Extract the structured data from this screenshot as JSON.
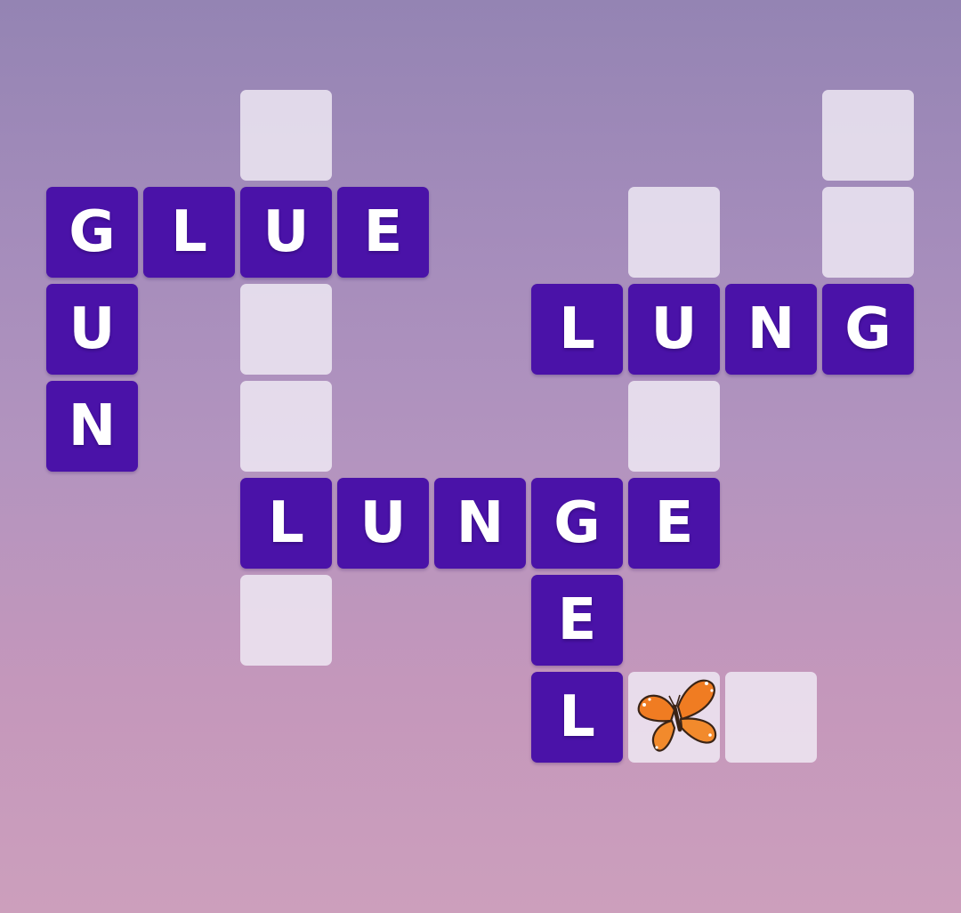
{
  "puzzle": {
    "found_words": [
      "GLUE",
      "GUN",
      "LUNG",
      "LUNGE",
      "GEL"
    ],
    "tiles": [
      {
        "row": 0,
        "col": 2,
        "letter": "",
        "state": "empty"
      },
      {
        "row": 0,
        "col": 8,
        "letter": "",
        "state": "empty"
      },
      {
        "row": 1,
        "col": 0,
        "letter": "G",
        "state": "filled"
      },
      {
        "row": 1,
        "col": 1,
        "letter": "L",
        "state": "filled"
      },
      {
        "row": 1,
        "col": 2,
        "letter": "U",
        "state": "filled"
      },
      {
        "row": 1,
        "col": 3,
        "letter": "E",
        "state": "filled"
      },
      {
        "row": 1,
        "col": 6,
        "letter": "",
        "state": "empty"
      },
      {
        "row": 1,
        "col": 8,
        "letter": "",
        "state": "empty"
      },
      {
        "row": 2,
        "col": 0,
        "letter": "U",
        "state": "filled"
      },
      {
        "row": 2,
        "col": 2,
        "letter": "",
        "state": "empty"
      },
      {
        "row": 2,
        "col": 5,
        "letter": "L",
        "state": "filled"
      },
      {
        "row": 2,
        "col": 6,
        "letter": "U",
        "state": "filled"
      },
      {
        "row": 2,
        "col": 7,
        "letter": "N",
        "state": "filled"
      },
      {
        "row": 2,
        "col": 8,
        "letter": "G",
        "state": "filled"
      },
      {
        "row": 3,
        "col": 0,
        "letter": "N",
        "state": "filled"
      },
      {
        "row": 3,
        "col": 2,
        "letter": "",
        "state": "empty"
      },
      {
        "row": 3,
        "col": 6,
        "letter": "",
        "state": "empty"
      },
      {
        "row": 4,
        "col": 2,
        "letter": "L",
        "state": "filled"
      },
      {
        "row": 4,
        "col": 3,
        "letter": "U",
        "state": "filled"
      },
      {
        "row": 4,
        "col": 4,
        "letter": "N",
        "state": "filled"
      },
      {
        "row": 4,
        "col": 5,
        "letter": "G",
        "state": "filled"
      },
      {
        "row": 4,
        "col": 6,
        "letter": "E",
        "state": "filled"
      },
      {
        "row": 5,
        "col": 2,
        "letter": "",
        "state": "empty"
      },
      {
        "row": 5,
        "col": 5,
        "letter": "E",
        "state": "filled"
      },
      {
        "row": 6,
        "col": 5,
        "letter": "L",
        "state": "filled"
      },
      {
        "row": 6,
        "col": 6,
        "letter": "",
        "state": "empty",
        "icon": "butterfly-icon"
      },
      {
        "row": 6,
        "col": 7,
        "letter": "",
        "state": "empty"
      }
    ]
  },
  "colors": {
    "tile_filled": "#4a12a8",
    "tile_empty": "#f0ecf5",
    "letter": "#ffffff",
    "butterfly_wing": "#f07c22",
    "butterfly_body": "#3a2416"
  }
}
